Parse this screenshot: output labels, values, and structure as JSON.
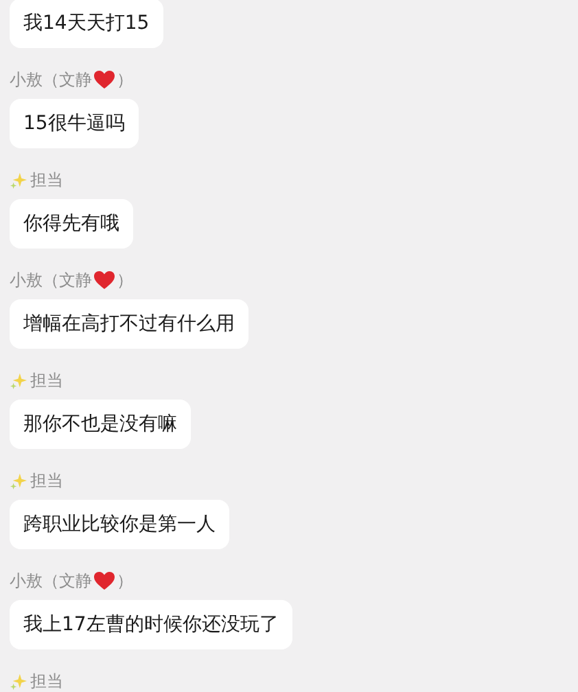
{
  "messages": [
    {
      "kind": "bubble",
      "text": "我14天天打15"
    },
    {
      "kind": "heart_sender",
      "name": "小敖（文静",
      "suffix": "）"
    },
    {
      "kind": "bubble",
      "text": "15很牛逼吗"
    },
    {
      "kind": "sparkle_sender",
      "name": "担当"
    },
    {
      "kind": "bubble",
      "text": "你得先有哦"
    },
    {
      "kind": "heart_sender",
      "name": "小敖（文静",
      "suffix": "）"
    },
    {
      "kind": "bubble",
      "text": "增幅在高打不过有什么用"
    },
    {
      "kind": "sparkle_sender",
      "name": "担当"
    },
    {
      "kind": "bubble",
      "text": "那你不也是没有嘛"
    },
    {
      "kind": "sparkle_sender",
      "name": "担当"
    },
    {
      "kind": "bubble",
      "text": "跨职业比较你是第一人"
    },
    {
      "kind": "heart_sender",
      "name": "小敖（文静",
      "suffix": "）"
    },
    {
      "kind": "bubble",
      "text": "我上17左曹的时候你还没玩了"
    },
    {
      "kind": "sparkle_sender",
      "name": "担当"
    }
  ]
}
